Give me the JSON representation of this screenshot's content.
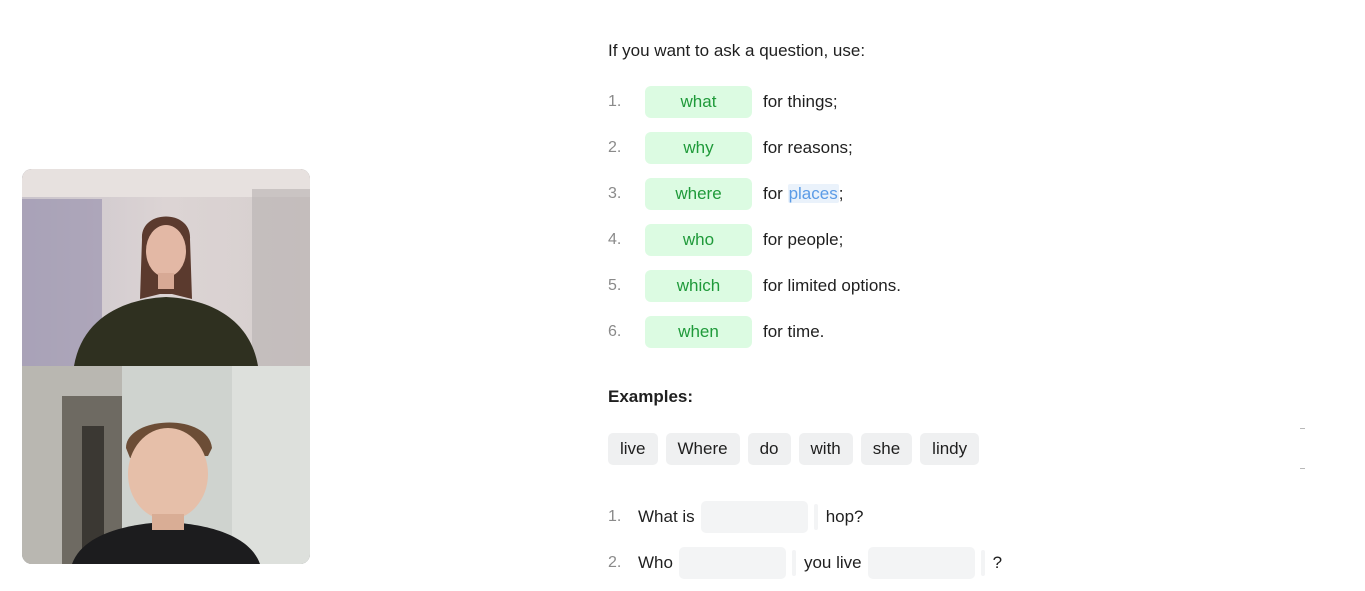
{
  "intro": "If you want to ask a question, use:",
  "question_words": [
    {
      "num": "1.",
      "word": "what",
      "desc": "for things;"
    },
    {
      "num": "2.",
      "word": "why",
      "desc": "for reasons;"
    },
    {
      "num": "3.",
      "word": "where",
      "desc_prefix": "for ",
      "desc_highlight": "places",
      "desc_suffix": ";"
    },
    {
      "num": "4.",
      "word": "who",
      "desc": "for people;"
    },
    {
      "num": "5.",
      "word": "which",
      "desc": "for limited options."
    },
    {
      "num": "6.",
      "word": "when",
      "desc": "for time."
    }
  ],
  "examples_heading": "Examples:",
  "word_bank": [
    "live",
    "Where",
    "do",
    "with",
    "she",
    "lindy"
  ],
  "exercises": [
    {
      "num": "1.",
      "before": "What is",
      "after": "hop?"
    },
    {
      "num": "2.",
      "before": "Who",
      "middle": "you live",
      "after": "?"
    }
  ],
  "colors": {
    "pill_bg": "#dcfbe2",
    "pill_text": "#1f9a3a",
    "highlight": "#5b9be6",
    "chip_bg": "#eff0f1"
  }
}
